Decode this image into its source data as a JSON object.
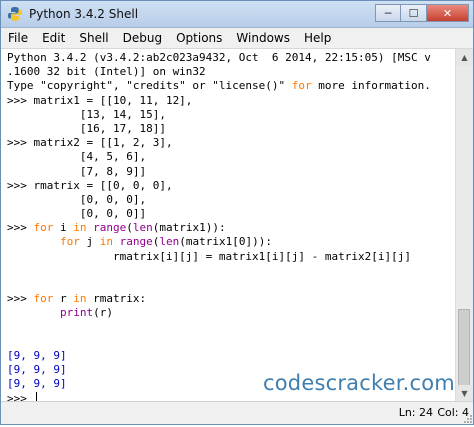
{
  "window": {
    "title": "Python 3.4.2 Shell",
    "controls": {
      "minimize": "─",
      "maximize": "☐",
      "close": "✕"
    }
  },
  "menu": [
    "File",
    "Edit",
    "Shell",
    "Debug",
    "Options",
    "Windows",
    "Help"
  ],
  "shell_lines": [
    "Python 3.4.2 (v3.4.2:ab2c023a9432, Oct  6 2014, 22:15:05) [MSC v",
    ".1600 32 bit (Intel)] on win32",
    "Type \"copyright\", \"credits\" or \"license()\" for more information.",
    ">>> matrix1 = [[10, 11, 12],",
    "           [13, 14, 15],",
    "           [16, 17, 18]]",
    ">>> matrix2 = [[1, 2, 3],",
    "           [4, 5, 6],",
    "           [7, 8, 9]]",
    ">>> rmatrix = [[0, 0, 0],",
    "           [0, 0, 0],",
    "           [0, 0, 0]]",
    ">>> for i in range(len(matrix1)):",
    "        for j in range(len(matrix1[0])):",
    "                rmatrix[i][j] = matrix1[i][j] - matrix2[i][j]",
    "",
    "",
    ">>> for r in rmatrix:",
    "        print(r)",
    "",
    "",
    "[9, 9, 9]",
    "[9, 9, 9]",
    "[9, 9, 9]",
    ">>> "
  ],
  "watermark": "codescracker.com",
  "status": {
    "line": "Ln: 24",
    "col": "Col: 4"
  },
  "colors": {
    "keyword": "#ff7700",
    "builtin": "#900090",
    "output": "#0000c0",
    "watermark": "#3f7fb0"
  }
}
